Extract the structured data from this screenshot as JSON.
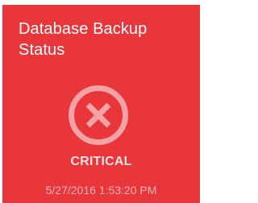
{
  "tile": {
    "title": "Database Backup Status",
    "status": "CRITICAL",
    "timestamp": "5/27/2016 1:53:20 PM",
    "icon": "critical-x-circle-icon",
    "colors": {
      "background": "#e8363b",
      "icon": "#f3a3a5",
      "status_text": "#fbe0e0",
      "timestamp_text": "#f6b4b6"
    }
  }
}
